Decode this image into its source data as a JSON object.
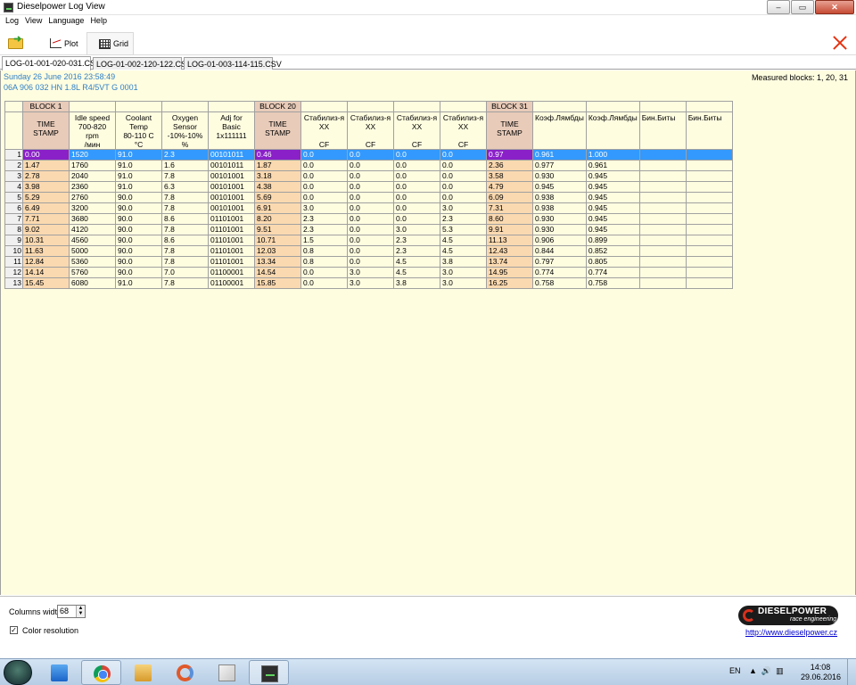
{
  "window": {
    "title": "Dieselpower Log View",
    "minimize": "–",
    "maximize": "▭",
    "close": "✕"
  },
  "menu": [
    "Log",
    "View",
    "Language",
    "Help"
  ],
  "toolbar": {
    "plot_label": "Plot",
    "grid_label": "Grid"
  },
  "file_tabs": [
    "LOG-01-001-020-031.CSV",
    "LOG-01-002-120-122.CSV",
    "LOG-01-003-114-115.CSV"
  ],
  "info": {
    "date_line": "Sunday 26 June 2016 23:58:49",
    "ecu_line": "06A 906 032 HN  1.8L R4/5VT    G   0001",
    "measured": "Measured blocks: 1, 20, 31"
  },
  "grid": {
    "block_labels": {
      "b1": "BLOCK 1",
      "b20": "BLOCK 20",
      "b31": "BLOCK 31"
    },
    "headers": [
      {
        "lines": [
          "TIME",
          "STAMP"
        ],
        "ts": true
      },
      {
        "lines": [
          "Idle speed",
          "700-820 rpm",
          "/мин"
        ]
      },
      {
        "lines": [
          "Coolant Temp",
          "80-110 C",
          "°C"
        ]
      },
      {
        "lines": [
          "Oxygen",
          "Sensor",
          "-10%-10%",
          "%"
        ]
      },
      {
        "lines": [
          "Adj for Basic",
          "1x111111"
        ]
      },
      {
        "lines": [
          "TIME",
          "STAMP"
        ],
        "ts": true
      },
      {
        "lines": [
          "Стабилиз-я",
          "XX",
          "",
          "CF"
        ]
      },
      {
        "lines": [
          "Стабилиз-я",
          "XX",
          "",
          "CF"
        ]
      },
      {
        "lines": [
          "Стабилиз-я",
          "XX",
          "",
          "CF"
        ]
      },
      {
        "lines": [
          "Стабилиз-я",
          "XX",
          "",
          "CF"
        ]
      },
      {
        "lines": [
          "TIME",
          "STAMP"
        ],
        "ts": true
      },
      {
        "lines": [
          "Коэф.Лямбды"
        ],
        "left": true
      },
      {
        "lines": [
          "Коэф.Лямбды"
        ],
        "left": true
      },
      {
        "lines": [
          "Бин.Биты"
        ],
        "left": true
      },
      {
        "lines": [
          "Бин.Биты"
        ],
        "left": true
      }
    ],
    "rows": [
      [
        "1",
        "0.00",
        "1520",
        "91.0",
        "2.3",
        "00101011",
        "0.46",
        "0.0",
        "0.0",
        "0.0",
        "0.0",
        "0.97",
        "0.961",
        "1.000",
        "",
        ""
      ],
      [
        "2",
        "1.47",
        "1760",
        "91.0",
        "1.6",
        "00101011",
        "1.87",
        "0.0",
        "0.0",
        "0.0",
        "0.0",
        "2.36",
        "0.977",
        "0.961",
        "",
        ""
      ],
      [
        "3",
        "2.78",
        "2040",
        "91.0",
        "7.8",
        "00101001",
        "3.18",
        "0.0",
        "0.0",
        "0.0",
        "0.0",
        "3.58",
        "0.930",
        "0.945",
        "",
        ""
      ],
      [
        "4",
        "3.98",
        "2360",
        "91.0",
        "6.3",
        "00101001",
        "4.38",
        "0.0",
        "0.0",
        "0.0",
        "0.0",
        "4.79",
        "0.945",
        "0.945",
        "",
        ""
      ],
      [
        "5",
        "5.29",
        "2760",
        "90.0",
        "7.8",
        "00101001",
        "5.69",
        "0.0",
        "0.0",
        "0.0",
        "0.0",
        "6.09",
        "0.938",
        "0.945",
        "",
        ""
      ],
      [
        "6",
        "6.49",
        "3200",
        "90.0",
        "7.8",
        "00101001",
        "6.91",
        "3.0",
        "0.0",
        "0.0",
        "3.0",
        "7.31",
        "0.938",
        "0.945",
        "",
        ""
      ],
      [
        "7",
        "7.71",
        "3680",
        "90.0",
        "8.6",
        "01101001",
        "8.20",
        "2.3",
        "0.0",
        "0.0",
        "2.3",
        "8.60",
        "0.930",
        "0.945",
        "",
        ""
      ],
      [
        "8",
        "9.02",
        "4120",
        "90.0",
        "7.8",
        "01101001",
        "9.51",
        "2.3",
        "0.0",
        "3.0",
        "5.3",
        "9.91",
        "0.930",
        "0.945",
        "",
        ""
      ],
      [
        "9",
        "10.31",
        "4560",
        "90.0",
        "8.6",
        "01101001",
        "10.71",
        "1.5",
        "0.0",
        "2.3",
        "4.5",
        "11.13",
        "0.906",
        "0.899",
        "",
        ""
      ],
      [
        "10",
        "11.63",
        "5000",
        "90.0",
        "7.8",
        "01101001",
        "12.03",
        "0.8",
        "0.0",
        "2.3",
        "4.5",
        "12.43",
        "0.844",
        "0.852",
        "",
        ""
      ],
      [
        "11",
        "12.84",
        "5360",
        "90.0",
        "7.8",
        "01101001",
        "13.34",
        "0.8",
        "0.0",
        "4.5",
        "3.8",
        "13.74",
        "0.797",
        "0.805",
        "",
        ""
      ],
      [
        "12",
        "14.14",
        "5760",
        "90.0",
        "7.0",
        "01100001",
        "14.54",
        "0.0",
        "3.0",
        "4.5",
        "3.0",
        "14.95",
        "0.774",
        "0.774",
        "",
        ""
      ],
      [
        "13",
        "15.45",
        "6080",
        "91.0",
        "7.8",
        "01100001",
        "15.85",
        "0.0",
        "3.0",
        "3.8",
        "3.0",
        "16.25",
        "0.758",
        "0.758",
        "",
        ""
      ]
    ]
  },
  "bottom": {
    "columns_width_label": "Columns width:",
    "columns_width_value": "68",
    "color_resolution_label": "Color resolution",
    "logo_name": "DIESELPOWER",
    "logo_sub": "race engineering",
    "site_url": "http://www.dieselpower.cz"
  },
  "taskbar": {
    "lang": "EN",
    "time": "14:08",
    "date": "29.06.2016"
  }
}
